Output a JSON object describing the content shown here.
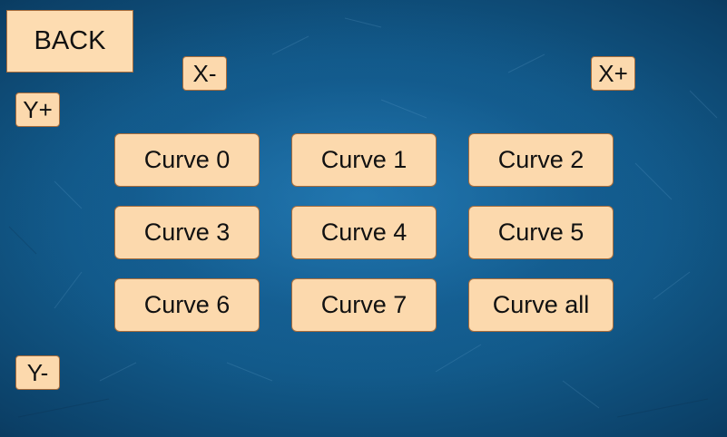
{
  "buttons": {
    "back": "BACK",
    "x_minus": "X-",
    "x_plus": "X+",
    "y_plus": "Y+",
    "y_minus": "Y-"
  },
  "curves": [
    "Curve 0",
    "Curve 1",
    "Curve 2",
    "Curve 3",
    "Curve 4",
    "Curve 5",
    "Curve 6",
    "Curve 7",
    "Curve all"
  ],
  "colors": {
    "background": "#125a8a",
    "button_fill": "#fcd9ad",
    "button_border": "#a86c3a"
  }
}
